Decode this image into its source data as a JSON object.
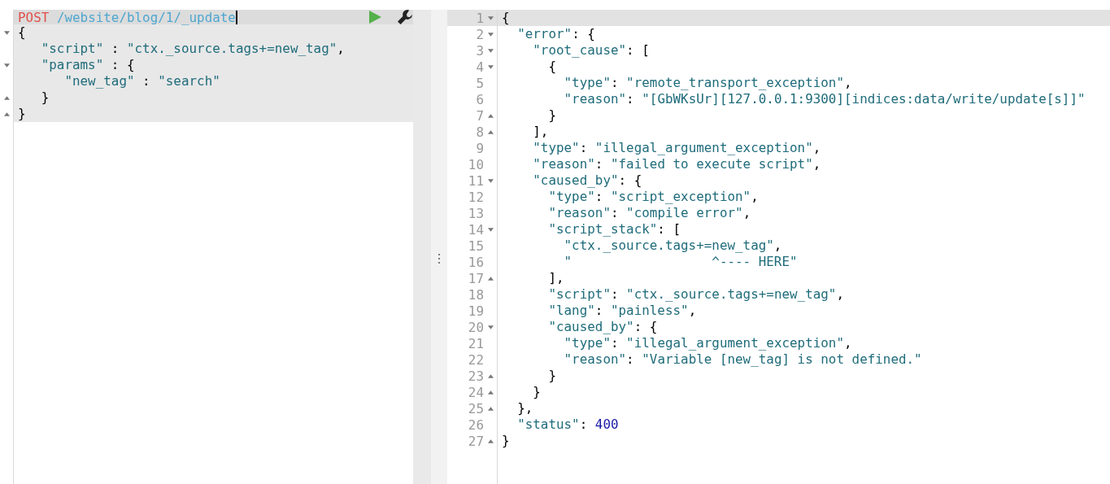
{
  "request": {
    "method": "POST",
    "path": "/website/blog/1/_update",
    "body": [
      {
        "text": "{",
        "kind": "open"
      },
      {
        "text": "   \"script\" : \"ctx._source.tags+=new_tag\",",
        "kind": "plain"
      },
      {
        "text": "   \"params\" : {",
        "kind": "open"
      },
      {
        "text": "      \"new_tag\" : \"search\"",
        "kind": "plain"
      },
      {
        "text": "   }",
        "kind": "close"
      },
      {
        "text": "}",
        "kind": "close"
      }
    ]
  },
  "response": {
    "lines": [
      {
        "number": "1",
        "text": "{",
        "kind": "open",
        "active": true
      },
      {
        "number": "2",
        "text": "  \"error\": {",
        "kind": "open",
        "active": false
      },
      {
        "number": "3",
        "text": "    \"root_cause\": [",
        "kind": "open",
        "active": false
      },
      {
        "number": "4",
        "text": "      {",
        "kind": "open",
        "active": false
      },
      {
        "number": "5",
        "text": "        \"type\": \"remote_transport_exception\",",
        "kind": "plain",
        "active": false
      },
      {
        "number": "6",
        "text": "        \"reason\": \"[GbWKsUr][127.0.0.1:9300][indices:data/write/update[s]]\"",
        "kind": "plain",
        "active": false
      },
      {
        "number": "7",
        "text": "      }",
        "kind": "close",
        "active": false
      },
      {
        "number": "8",
        "text": "    ],",
        "kind": "close",
        "active": false
      },
      {
        "number": "9",
        "text": "    \"type\": \"illegal_argument_exception\",",
        "kind": "plain",
        "active": false
      },
      {
        "number": "10",
        "text": "    \"reason\": \"failed to execute script\",",
        "kind": "plain",
        "active": false
      },
      {
        "number": "11",
        "text": "    \"caused_by\": {",
        "kind": "open",
        "active": false
      },
      {
        "number": "12",
        "text": "      \"type\": \"script_exception\",",
        "kind": "plain",
        "active": false
      },
      {
        "number": "13",
        "text": "      \"reason\": \"compile error\",",
        "kind": "plain",
        "active": false
      },
      {
        "number": "14",
        "text": "      \"script_stack\": [",
        "kind": "open",
        "active": false
      },
      {
        "number": "15",
        "text": "        \"ctx._source.tags+=new_tag\",",
        "kind": "plain",
        "active": false
      },
      {
        "number": "16",
        "text": "        \"                  ^---- HERE\"",
        "kind": "plain",
        "active": false
      },
      {
        "number": "17",
        "text": "      ],",
        "kind": "close",
        "active": false
      },
      {
        "number": "18",
        "text": "      \"script\": \"ctx._source.tags+=new_tag\",",
        "kind": "plain",
        "active": false
      },
      {
        "number": "19",
        "text": "      \"lang\": \"painless\",",
        "kind": "plain",
        "active": false
      },
      {
        "number": "20",
        "text": "      \"caused_by\": {",
        "kind": "open",
        "active": false
      },
      {
        "number": "21",
        "text": "        \"type\": \"illegal_argument_exception\",",
        "kind": "plain",
        "active": false
      },
      {
        "number": "22",
        "text": "        \"reason\": \"Variable [new_tag] is not defined.\"",
        "kind": "plain",
        "active": false
      },
      {
        "number": "23",
        "text": "      }",
        "kind": "close",
        "active": false
      },
      {
        "number": "24",
        "text": "    }",
        "kind": "close",
        "active": false
      },
      {
        "number": "25",
        "text": "  },",
        "kind": "close",
        "active": false
      },
      {
        "number": "26",
        "text": "  \"status\": 400",
        "kind": "plain",
        "active": false
      },
      {
        "number": "27",
        "text": "}",
        "kind": "close",
        "active": false
      }
    ]
  }
}
